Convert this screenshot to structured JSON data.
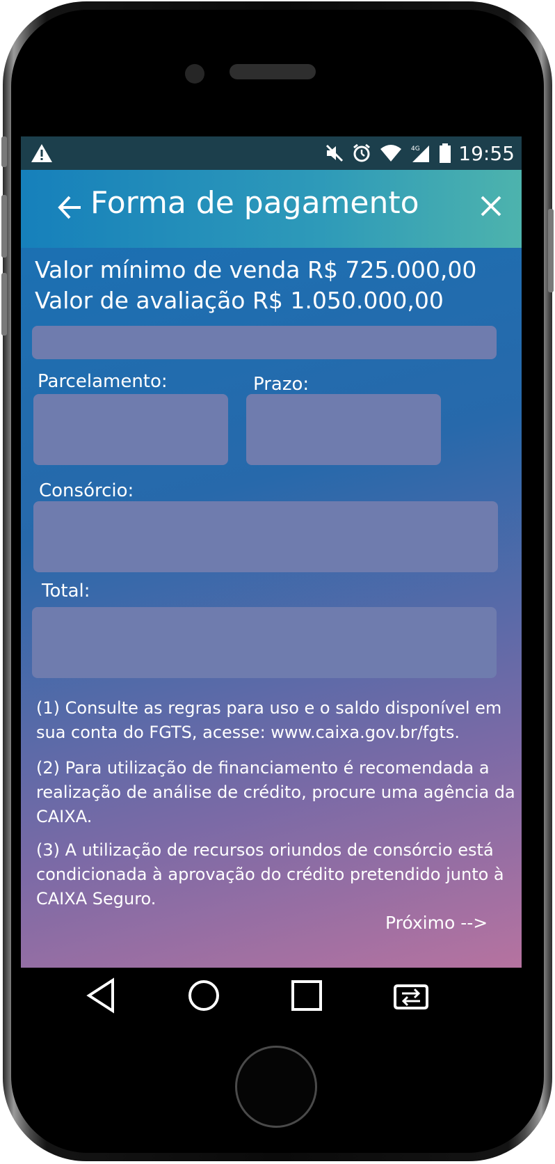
{
  "status_bar": {
    "time": "19:55",
    "network": "4G",
    "icons": [
      "warning-icon",
      "mute-icon",
      "alarm-icon",
      "wifi-icon",
      "signal-icon",
      "battery-icon"
    ]
  },
  "header": {
    "title": "Forma de pagamento",
    "back_icon": "arrow-left-icon",
    "close_icon": "close-icon"
  },
  "values": {
    "min_sale": "Valor mínimo de venda R$ 725.000,00",
    "appraisal": "Valor de avaliação R$ 1.050.000,00"
  },
  "form": {
    "parcelamento_label": "Parcelamento:",
    "prazo_label": "Prazo:",
    "consorcio_label": "Consórcio:",
    "total_label": "Total:"
  },
  "notes": {
    "note1": "(1) Consulte as regras para uso e o saldo disponível em sua conta do FGTS, acesse: www.caixa.gov.br/fgts.",
    "note2": "(2) Para utilização de financiamento é recomendada a realização de análise de crédito, procure uma agência da CAIXA.",
    "note3": "(3) A utilização de recursos oriundos de consórcio está condicionada à aprovação do crédito pretendido junto à CAIXA Seguro."
  },
  "next_label": "Próximo -->",
  "nav_bar": {
    "icons": [
      "back-triangle-icon",
      "home-circle-icon",
      "recents-square-icon",
      "switch-app-icon"
    ]
  },
  "colors": {
    "status_bar": "#1c3f4c",
    "header_start": "#1680bb",
    "header_end": "#4db3ad",
    "field": "#6f7cae",
    "background_top": "#1872b4",
    "background_bottom": "#b673a0"
  }
}
